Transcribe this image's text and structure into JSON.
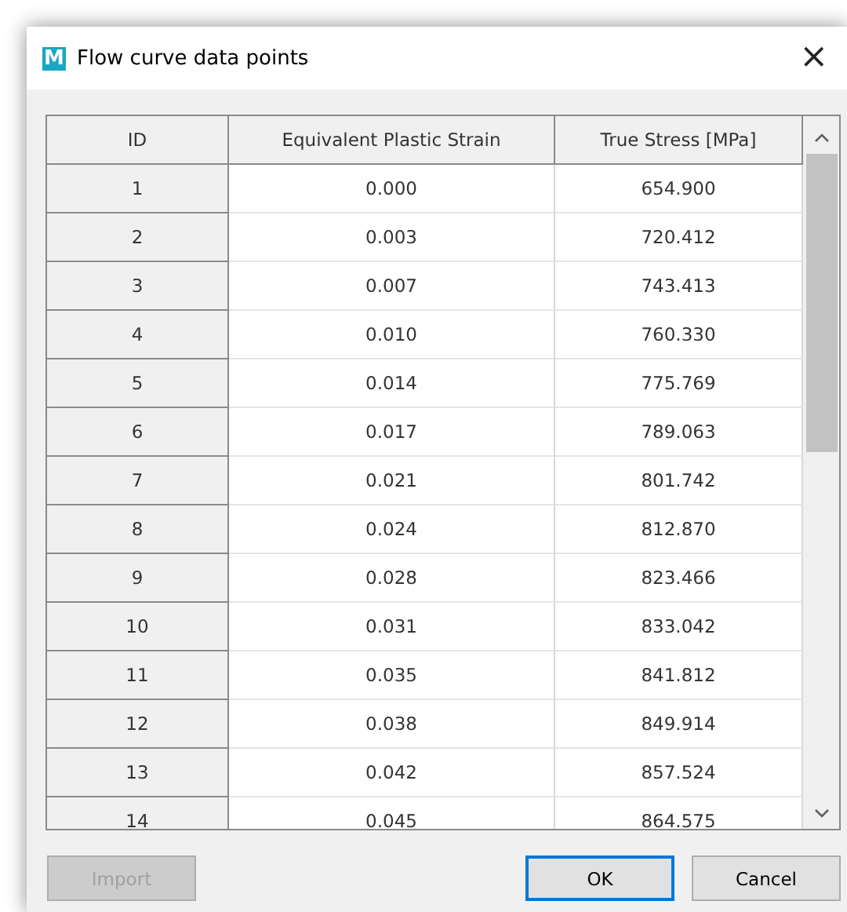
{
  "window": {
    "title": "Flow curve data points",
    "icon_letter": "M",
    "close": "×"
  },
  "table": {
    "columns": [
      "ID",
      "Equivalent Plastic Strain",
      "True Stress [MPa]"
    ],
    "rows": [
      [
        "1",
        "0.000",
        "654.900"
      ],
      [
        "2",
        "0.003",
        "720.412"
      ],
      [
        "3",
        "0.007",
        "743.413"
      ],
      [
        "4",
        "0.010",
        "760.330"
      ],
      [
        "5",
        "0.014",
        "775.769"
      ],
      [
        "6",
        "0.017",
        "789.063"
      ],
      [
        "7",
        "0.021",
        "801.742"
      ],
      [
        "8",
        "0.024",
        "812.870"
      ],
      [
        "9",
        "0.028",
        "823.466"
      ],
      [
        "10",
        "0.031",
        "833.042"
      ],
      [
        "11",
        "0.035",
        "841.812"
      ],
      [
        "12",
        "0.038",
        "849.914"
      ],
      [
        "13",
        "0.042",
        "857.524"
      ],
      [
        "14",
        "0.045",
        "864.575"
      ]
    ]
  },
  "buttons": [
    {
      "label": "Import",
      "disabled": true,
      "kind": "left"
    },
    {
      "label": "OK",
      "disabled": false,
      "kind": "default"
    },
    {
      "label": "Cancel",
      "disabled": false,
      "kind": "normal"
    }
  ]
}
